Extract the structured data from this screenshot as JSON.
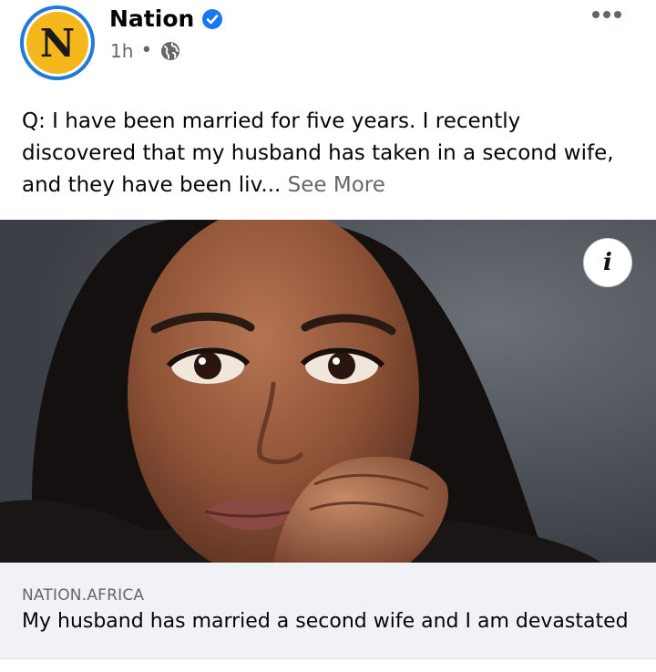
{
  "post": {
    "page_name": "Nation",
    "avatar_letter": "N",
    "time": "1h",
    "separator": "•",
    "verified_icon": "verified-badge-icon",
    "audience_icon": "globe-icon",
    "more_icon": "more-options-icon",
    "text": "Q: I have been married for five years. I recently discovered that my husband has taken in a second wife, and they have been liv...",
    "see_more": "See More"
  },
  "image": {
    "info_label": "i"
  },
  "link": {
    "domain": "NATION.AFRICA",
    "title": "My husband has married a second wife and I am devastated"
  },
  "colors": {
    "verified_blue": "#1877f2",
    "avatar_ring": "#1f7ad9",
    "avatar_fill": "#f5b81c",
    "link_bg": "#f0f2f5"
  }
}
